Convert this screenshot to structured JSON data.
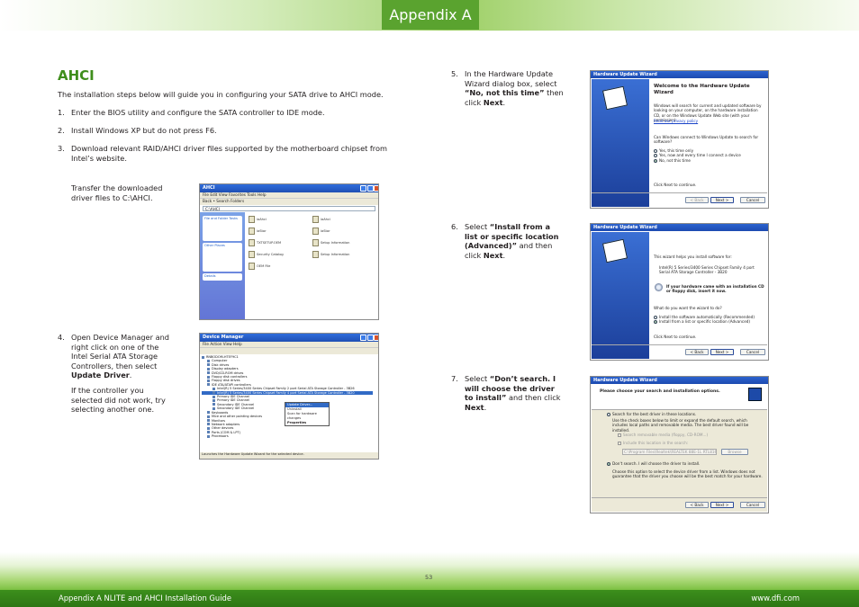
{
  "header": {
    "tab_label": "Appendix A"
  },
  "section": {
    "title": "AHCI"
  },
  "intro": "The installation steps below will guide you in configuring your SATA drive to AHCI mode.",
  "steps": [
    {
      "number": "1.",
      "text": "Enter the BIOS utility and configure the SATA controller to IDE mode."
    },
    {
      "number": "2.",
      "text": "Install Windows XP but do not press F6."
    },
    {
      "number": "3.",
      "text": "Download relevant RAID/AHCI driver files supported by the motherboard chipset from Intel’s website."
    }
  ],
  "step3_extra": "Transfer the downloaded driver files to C:\\AHCI.",
  "step4": {
    "number": "4.",
    "lines": [
      "Open Device Manager and",
      "right click on one of the",
      "Intel Serial ATA Storage",
      "Controllers, then select"
    ],
    "bold": "Update Driver",
    "period": ".",
    "note_lines": [
      "If the controller you",
      "selected did not work, try",
      "selecting another one."
    ]
  },
  "step5": {
    "number": "5.",
    "line1": "In the Hardware Update",
    "line2": "Wizard dialog box, select",
    "bold": "“No, not this time”",
    "after_bold": " then",
    "line4_pre": "click ",
    "line4_bold": "Next",
    "line4_post": "."
  },
  "step6": {
    "number": "6.",
    "pre": "Select ",
    "bold1": "“Install from a",
    "bold2": "list or specific location",
    "bold3": "(Advanced)”",
    "after": " and then",
    "line4_pre": "click ",
    "line4_bold": "Next",
    "line4_post": "."
  },
  "step7": {
    "number": "7.",
    "pre": "Select ",
    "bold1": "“Don’t search. I",
    "bold2": "will choose the driver",
    "bold3": "to install”",
    "after": " and then click",
    "line4_bold": "Next",
    "line4_post": "."
  },
  "explorer_shot": {
    "window_title": "AHCI",
    "menu": "File  Edit  View  Favorites  Tools  Help",
    "toolbar": "Back  •  Search  Folders",
    "address": "C:\\AHCI",
    "panel1_title": "File and Folder Tasks",
    "panel2_title": "Other Places",
    "panel3_title": "Details",
    "files": [
      "iaAhci",
      "iaAhci",
      "iaStor",
      "iaStor",
      "TXTSETUP.OEM",
      "Setup Information",
      "Security Catalog",
      "Setup Information",
      "OEM File"
    ]
  },
  "devmgr_shot": {
    "window_title": "Device Manager",
    "menu": "File  Action  View  Help",
    "tree": [
      "RNBODOM-HTEF9C1",
      "Computer",
      "Disk drives",
      "Display adapters",
      "DVD/CD-ROM drives",
      "Floppy disk controllers",
      "Floppy disk drives",
      "IDE ATA/ATAPI controllers",
      "Intel(R) 5 Series/3400 Series Chipset Family 2 port Serial ATA Storage Controller - 3B26",
      "Intel(R) 5 Series/3400 Series Chipset Family 4 port Serial ATA Storage Controller - 3B20",
      "Primary IDE Channel",
      "Primary IDE Channel",
      "Secondary IDE Channel",
      "Secondary IDE Channel",
      "Keyboards",
      "Mice and other pointing devices",
      "Monitors",
      "Network adapters",
      "Other devices",
      "Ports (COM & LPT)",
      "Processors"
    ],
    "context_menu": [
      "Update Driver...",
      "Uninstall",
      "Scan for hardware changes",
      "Properties"
    ],
    "status": "Launches the Hardware Update Wizard for the selected device."
  },
  "wizard1": {
    "title": "Hardware Update Wizard",
    "heading": "Welcome to the Hardware Update Wizard",
    "desc": "Windows will search for current and updated software by looking on your computer, on the hardware installation CD, or on the Windows Update Web site (with your permission).",
    "link": "Read our privacy policy",
    "question": "Can Windows connect to Windows Update to search for software?",
    "options": [
      "Yes, this time only",
      "Yes, now and every time I connect a device",
      "No, not this time"
    ],
    "footer": "Click Next to continue.",
    "buttons": [
      "< Back",
      "Next >",
      "Cancel"
    ]
  },
  "wizard2": {
    "title": "Hardware Update Wizard",
    "line1": "This wizard helps you install software for:",
    "device": "Intel(R) 5 Series/3400 Series Chipset Family 4 port Serial ATA Storage Controller - 3B20",
    "cd_note": "If your hardware came with an installation CD or floppy disk, insert it now.",
    "question": "What do you want the wizard to do?",
    "options": [
      "Install the software automatically (Recommended)",
      "Install from a list or specific location (Advanced)"
    ],
    "footer": "Click Next to continue.",
    "buttons": [
      "< Back",
      "Next >",
      "Cancel"
    ]
  },
  "wizard3": {
    "title": "Hardware Update Wizard",
    "heading": "Please choose your search and installation options.",
    "opt1": "Search for the best driver in these locations.",
    "opt1_desc": "Use the check boxes below to limit or expand the default search, which includes local paths and removable media. The best driver found will be installed.",
    "check1": "Search removable media (floppy, CD-ROM...)",
    "check2": "Include this location in the search:",
    "path": "C:\\Program Files\\Realtek\\REALTEK 88E-1L RTL8168",
    "browse": "Browse",
    "opt2": "Don't search. I will choose the driver to install.",
    "opt2_desc": "Choose this option to select the device driver from a list. Windows does not guarantee that the driver you choose will be the best match for your hardware.",
    "buttons": [
      "< Back",
      "Next >",
      "Cancel"
    ]
  },
  "footer": {
    "page_number": "53",
    "left": "Appendix A NLITE and AHCI Installation Guide",
    "right": "www.dfi.com"
  }
}
